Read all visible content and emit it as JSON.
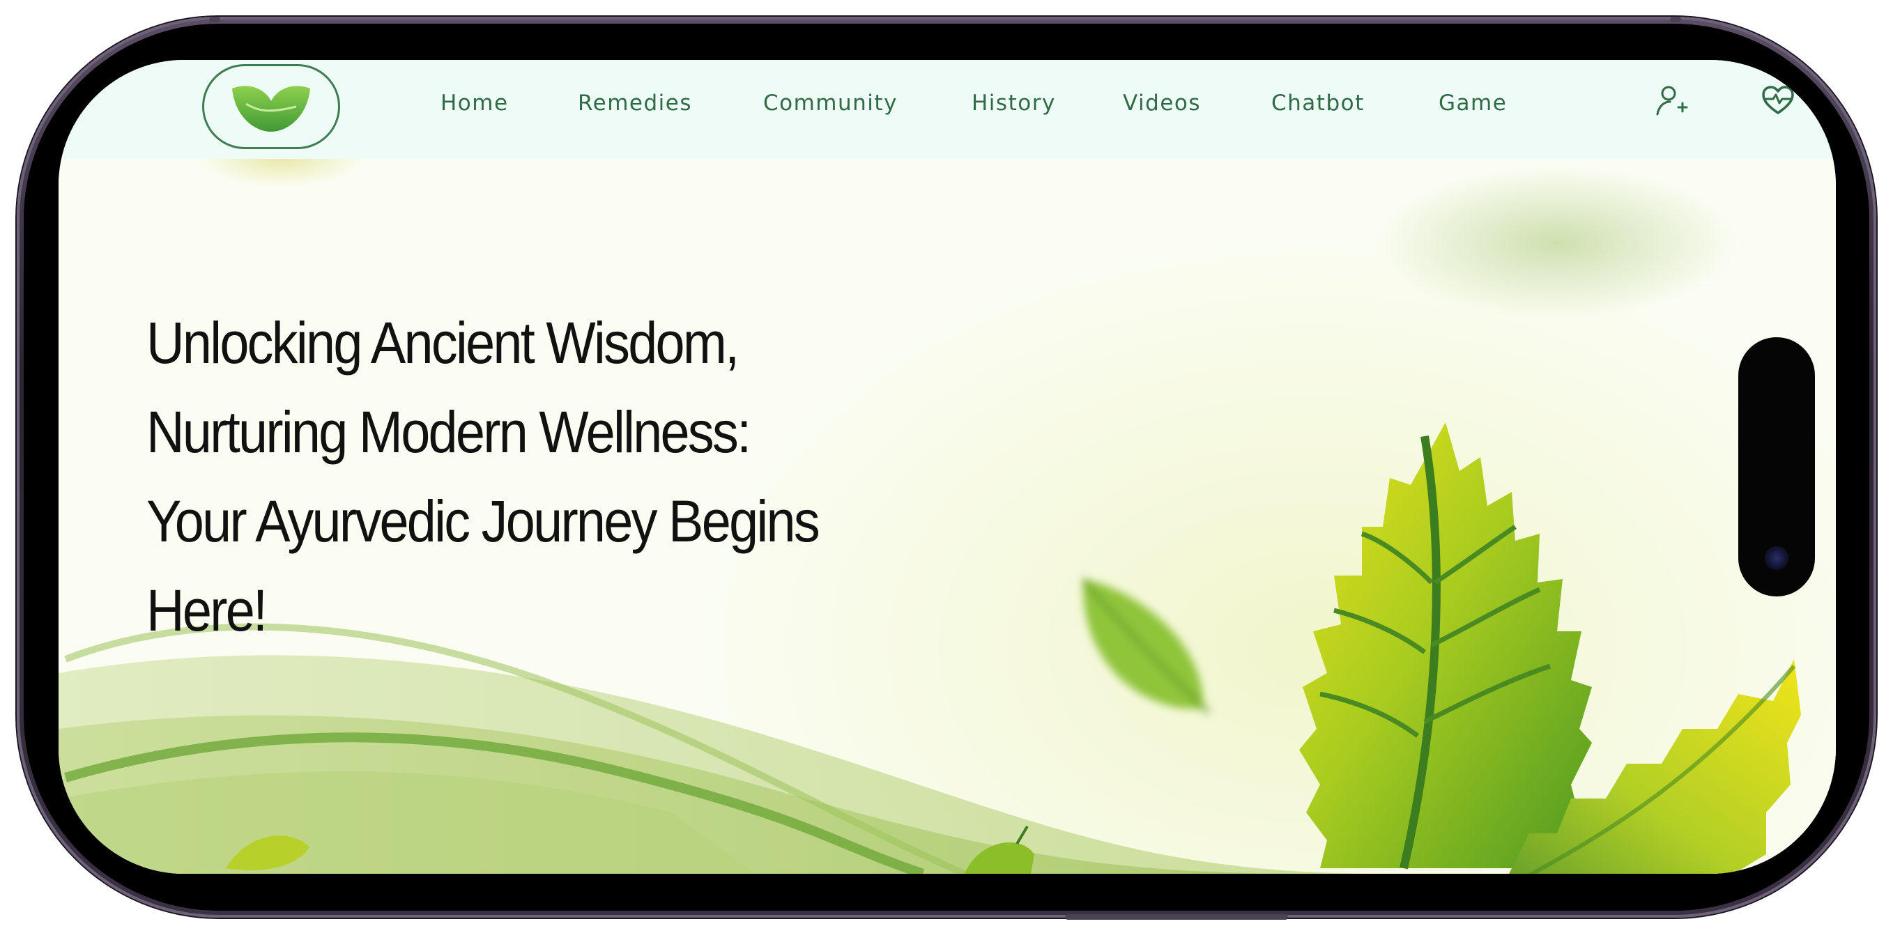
{
  "nav": {
    "links": [
      {
        "label": "Home"
      },
      {
        "label": "Remedies"
      },
      {
        "label": "Community"
      },
      {
        "label": "History"
      },
      {
        "label": "Videos"
      },
      {
        "label": "Chatbot"
      },
      {
        "label": "Game"
      }
    ],
    "icons": {
      "logo": "leaf-icon",
      "user": "add-user-icon",
      "health": "heart-pulse-icon"
    }
  },
  "hero": {
    "lines": [
      "Unlocking Ancient Wisdom,",
      "Nurturing Modern Wellness:",
      "Your Ayurvedic Journey Begins",
      "Here!"
    ]
  },
  "colors": {
    "nav_bg": "#eefbf7",
    "nav_text": "#2f6b45",
    "accent_green": "#5aa83a",
    "hero_bg": "#fbfdf3",
    "heading": "#111111"
  }
}
